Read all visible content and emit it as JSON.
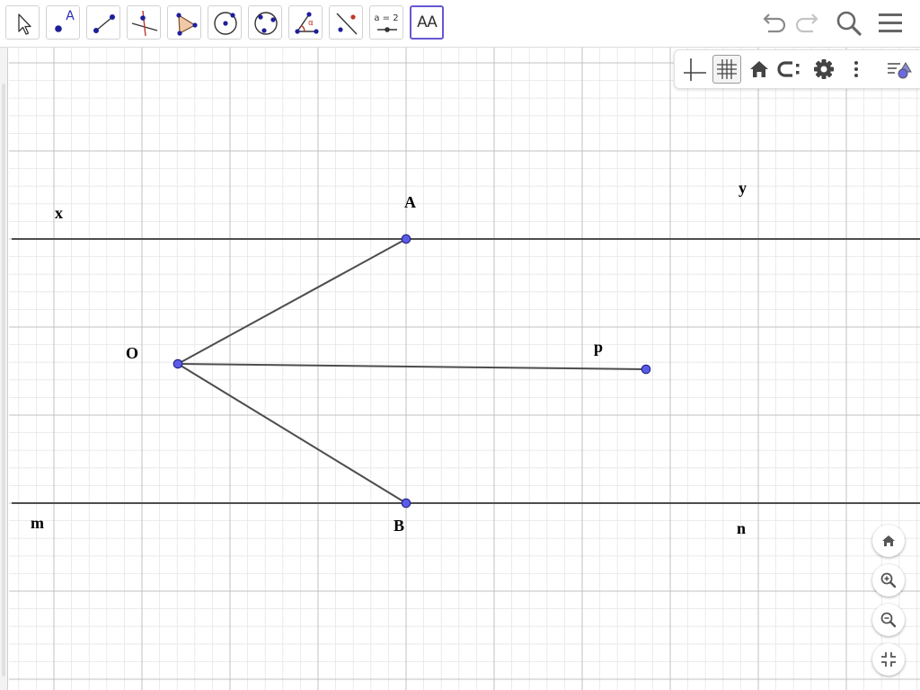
{
  "toolbar": {
    "tools": [
      {
        "name": "move"
      },
      {
        "name": "point",
        "glyph": "A"
      },
      {
        "name": "segment"
      },
      {
        "name": "perpendicular-line"
      },
      {
        "name": "polygon"
      },
      {
        "name": "circle-center-point"
      },
      {
        "name": "circle-three-points"
      },
      {
        "name": "angle",
        "glyph": "α"
      },
      {
        "name": "reflect-about-line"
      },
      {
        "name": "slider",
        "glyph": "a = 2"
      },
      {
        "name": "text",
        "glyph": "AA"
      }
    ],
    "active_tool": "text",
    "right_icons": [
      "undo-icon",
      "redo-icon",
      "search-icon",
      "menu-icon"
    ]
  },
  "style_bar": {
    "icons": [
      "axes-icon",
      "grid-icon",
      "home-icon",
      "point-capture-icon",
      "settings-icon",
      "more-icon",
      "algebra-toggle-icon"
    ],
    "grid_enabled": true
  },
  "zoom_controls": [
    "home-icon",
    "zoom-in-icon",
    "zoom-out-icon",
    "fullscreen-exit-icon"
  ],
  "colors": {
    "accent": "#6557d2",
    "point_fill": "#5b5ce6",
    "point_stroke": "#1a1a80",
    "line": "#4d4d4d",
    "grid_major": "#c0c0c0",
    "grid_minor": "#e6e6e6"
  },
  "graphics": {
    "labels": {
      "x": "x",
      "y": "y",
      "A": "A",
      "O": "O",
      "p": "p",
      "m": "m",
      "B": "B",
      "n": "n"
    }
  }
}
